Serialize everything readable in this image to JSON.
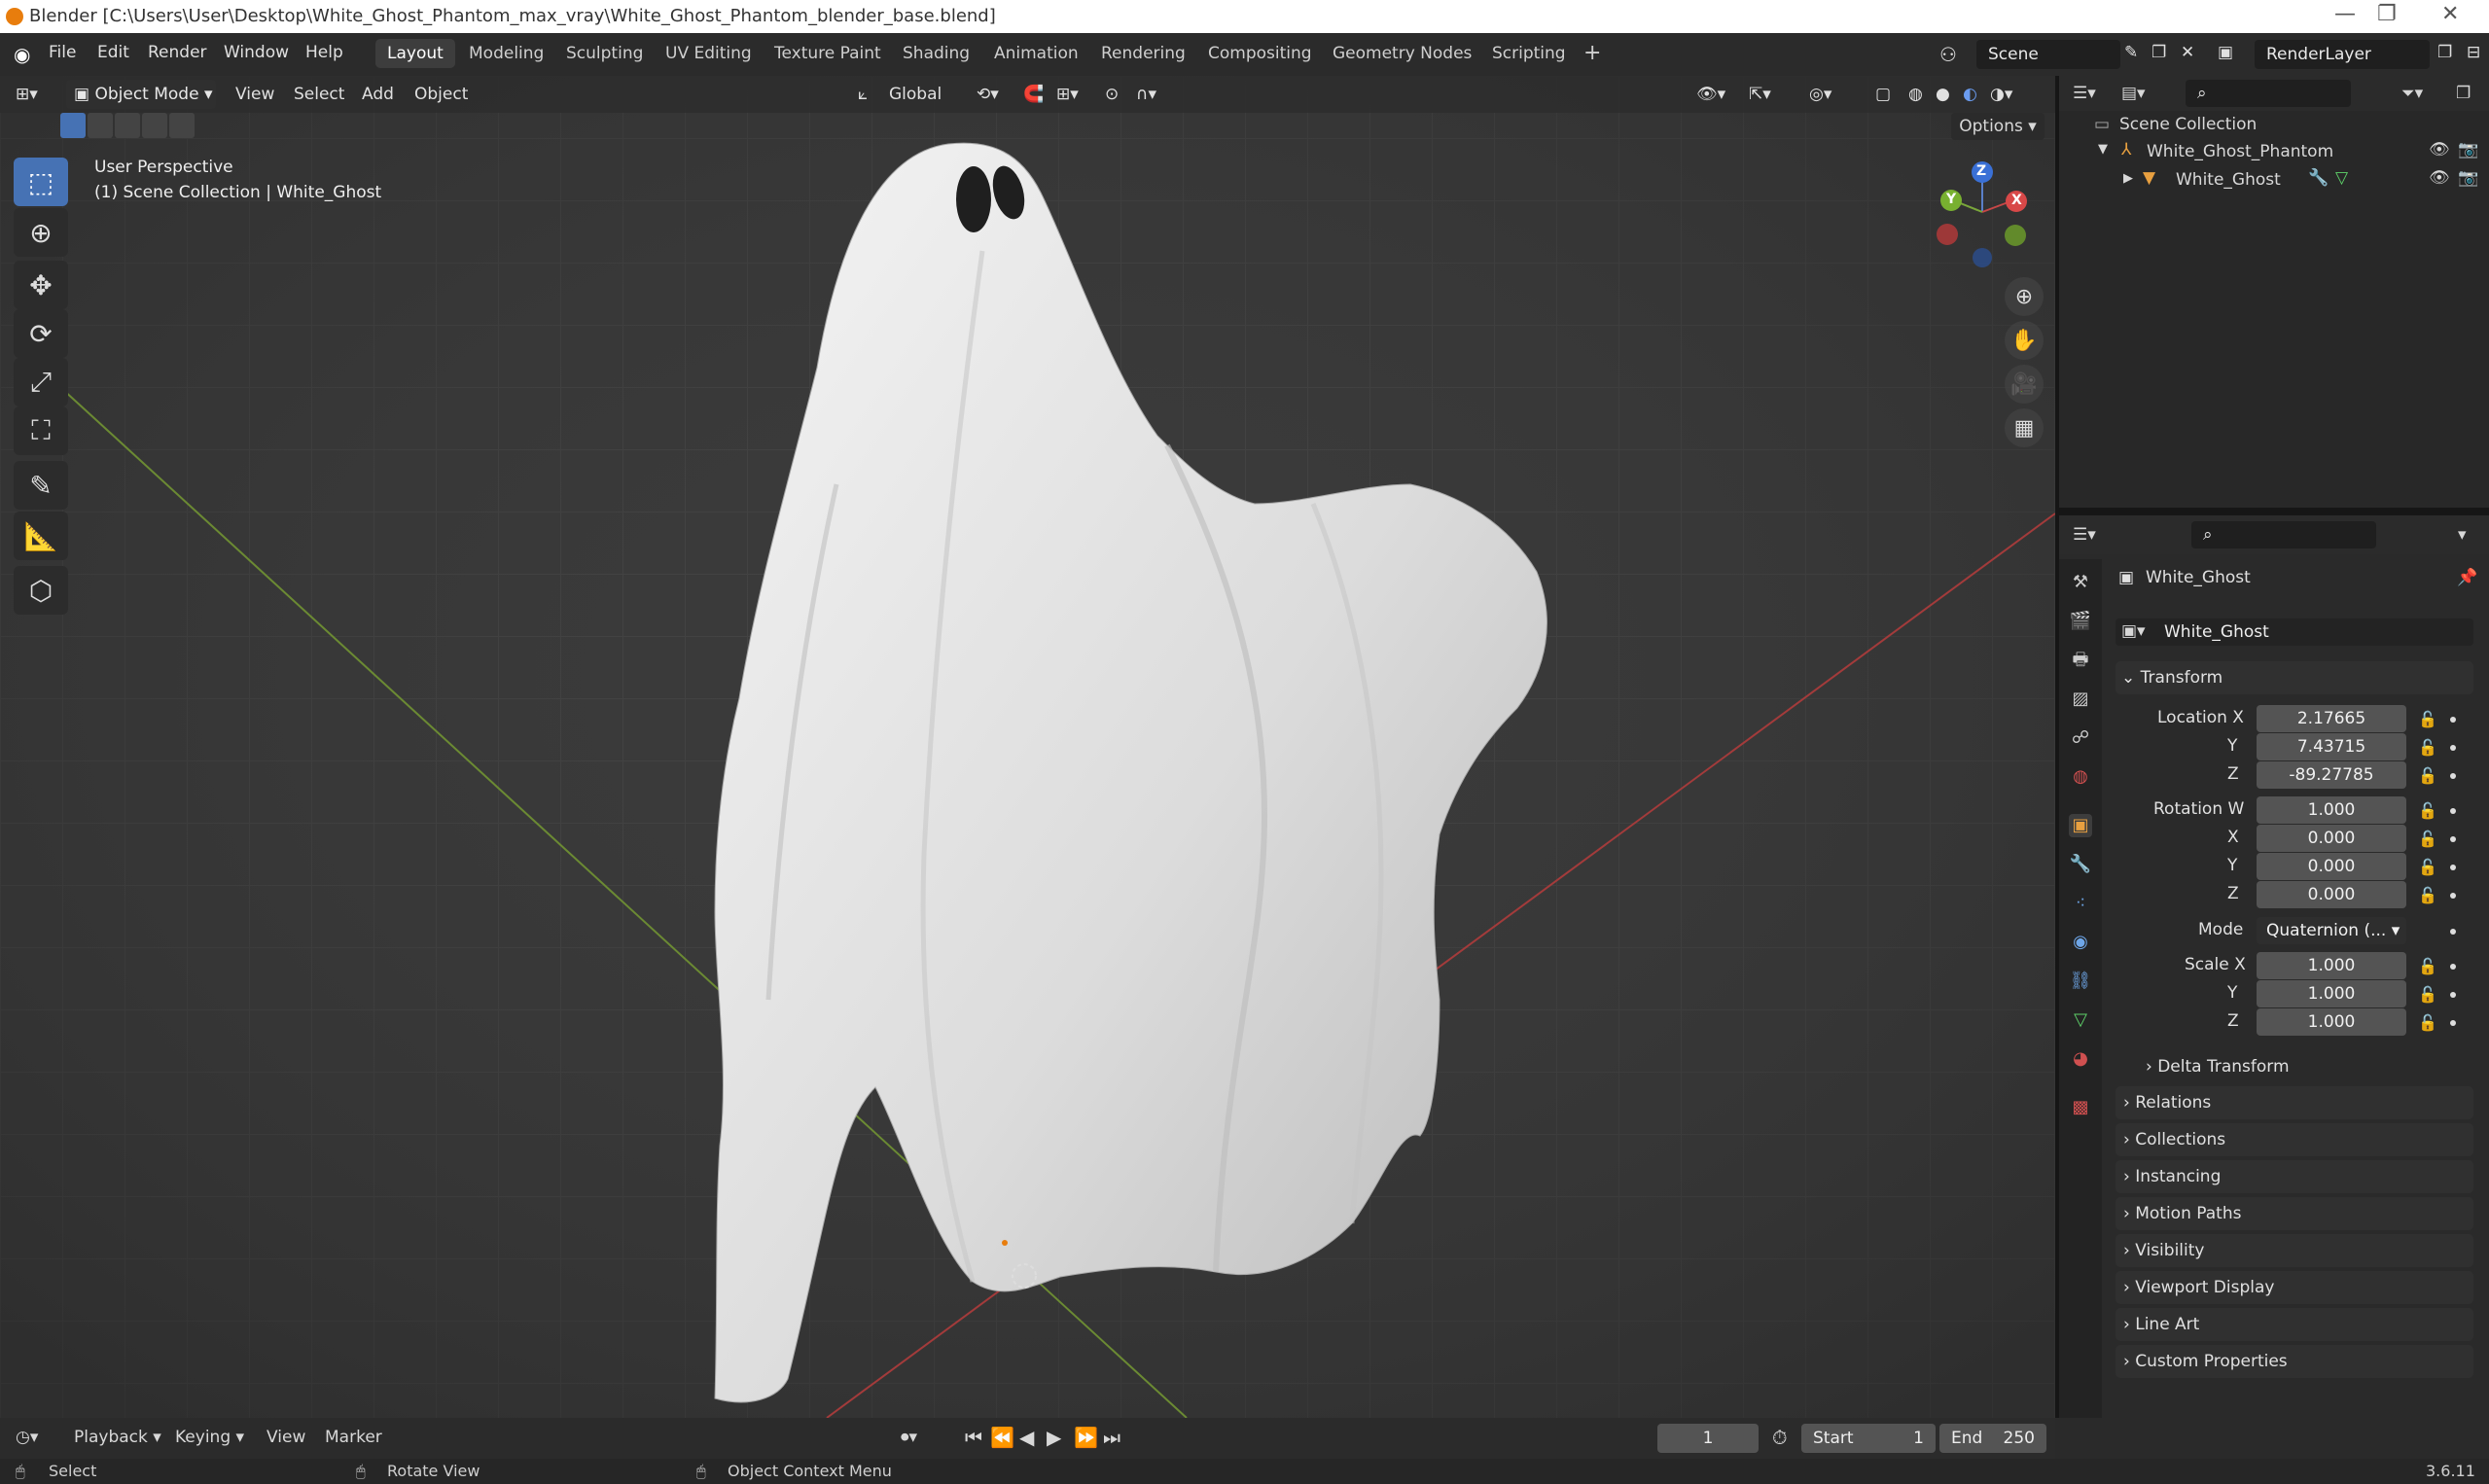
{
  "titlebar": {
    "title": "Blender [C:\\Users\\User\\Desktop\\White_Ghost_Phantom_max_vray\\White_Ghost_Phantom_blender_base.blend]"
  },
  "menu": {
    "file": "File",
    "edit": "Edit",
    "render": "Render",
    "window": "Window",
    "help": "Help"
  },
  "workspaces": [
    "Layout",
    "Modeling",
    "Sculpting",
    "UV Editing",
    "Texture Paint",
    "Shading",
    "Animation",
    "Rendering",
    "Compositing",
    "Geometry Nodes",
    "Scripting"
  ],
  "scene": {
    "name": "Scene",
    "render_layer": "RenderLayer"
  },
  "viewport": {
    "mode": "Object Mode",
    "menus": {
      "view": "View",
      "select": "Select",
      "add": "Add",
      "object": "Object"
    },
    "orientation": "Global",
    "options": "Options",
    "overlay_line1": "User Perspective",
    "overlay_line2": "(1) Scene Collection | White_Ghost",
    "gizmo": {
      "x": "X",
      "y": "Y",
      "z": "Z"
    }
  },
  "outliner": {
    "root": "Scene Collection",
    "collection": "White_Ghost_Phantom",
    "object": "White_Ghost"
  },
  "properties": {
    "object_name": "White_Ghost",
    "object_field": "White_Ghost",
    "transform_label": "Transform",
    "location_label": "Location X",
    "loc_x": "2.17665",
    "loc_y": "7.43715",
    "loc_z": "-89.27785",
    "rotation_label": "Rotation W",
    "rot_w": "1.000",
    "rot_x": "0.000",
    "rot_y": "0.000",
    "rot_z": "0.000",
    "mode_label": "Mode",
    "mode_value": "Quaternion (...",
    "scale_label": "Scale X",
    "scale_x": "1.000",
    "scale_y": "1.000",
    "scale_z": "1.000",
    "axis_y": "Y",
    "axis_z": "Z",
    "axis_x": "X",
    "sections": [
      "Delta Transform",
      "Relations",
      "Collections",
      "Instancing",
      "Motion Paths",
      "Visibility",
      "Viewport Display",
      "Line Art",
      "Custom Properties"
    ]
  },
  "timeline": {
    "playback": "Playback",
    "keying": "Keying",
    "view": "View",
    "marker": "Marker",
    "current_frame": "1",
    "start_label": "Start",
    "start": "1",
    "end_label": "End",
    "end": "250"
  },
  "statusbar": {
    "select": "Select",
    "rotate": "Rotate View",
    "context": "Object Context Menu",
    "version": "3.6.11"
  },
  "colors": {
    "accent": "#4672b4",
    "orange": "#e87d0d"
  }
}
